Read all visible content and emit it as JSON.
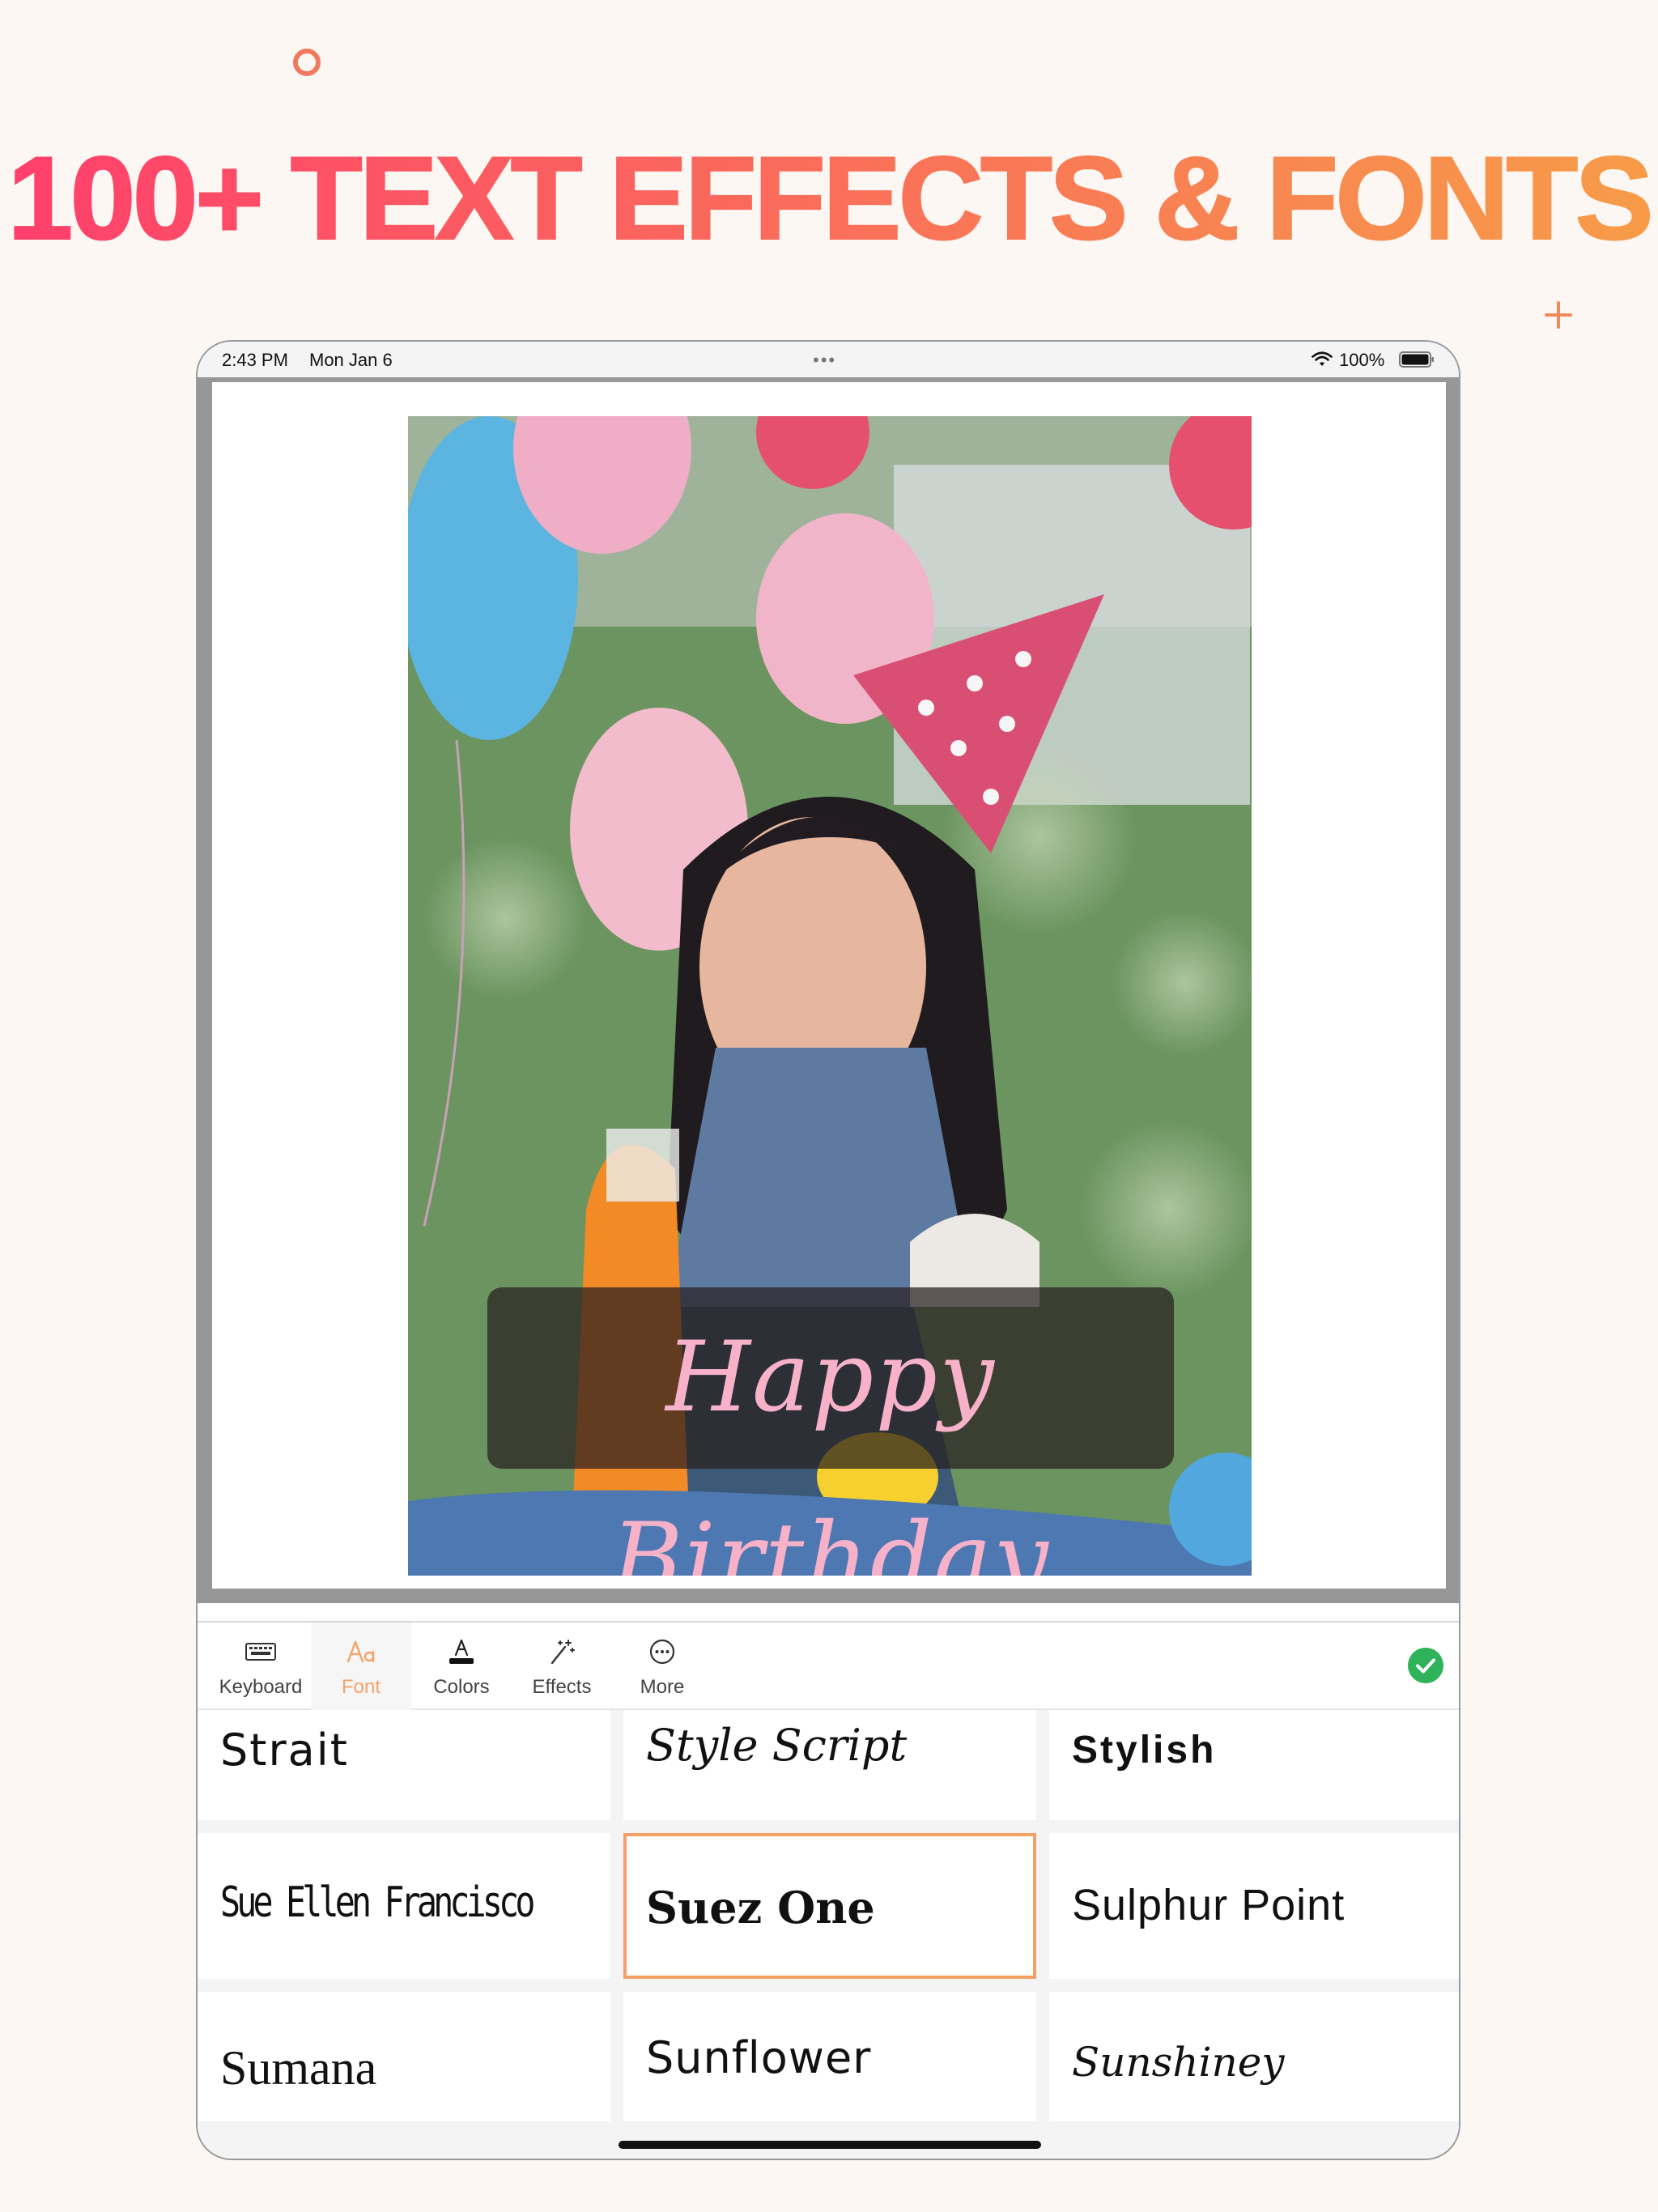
{
  "headline": "100+ TEXT EFFECTS & FONTS",
  "status_bar": {
    "time": "2:43 PM",
    "date": "Mon Jan 6",
    "battery": "100%"
  },
  "canvas": {
    "caption": "Happy Birthday"
  },
  "toolbar": {
    "keyboard": "Keyboard",
    "font": "Font",
    "colors": "Colors",
    "effects": "Effects",
    "more": "More"
  },
  "fonts": [
    "Strait",
    "Style Script",
    "Stylish",
    "Sue Ellen Francisco",
    "Suez One",
    "Sulphur Point",
    "Sumana",
    "Sunflower",
    "Sunshiney"
  ],
  "selected_font": "Suez One",
  "colors": {
    "accent": "#f2a066",
    "headline_start": "#ff3f6c",
    "headline_end": "#f79c48",
    "confirm": "#2eb35b",
    "caption_text": "#f7b2c9"
  }
}
